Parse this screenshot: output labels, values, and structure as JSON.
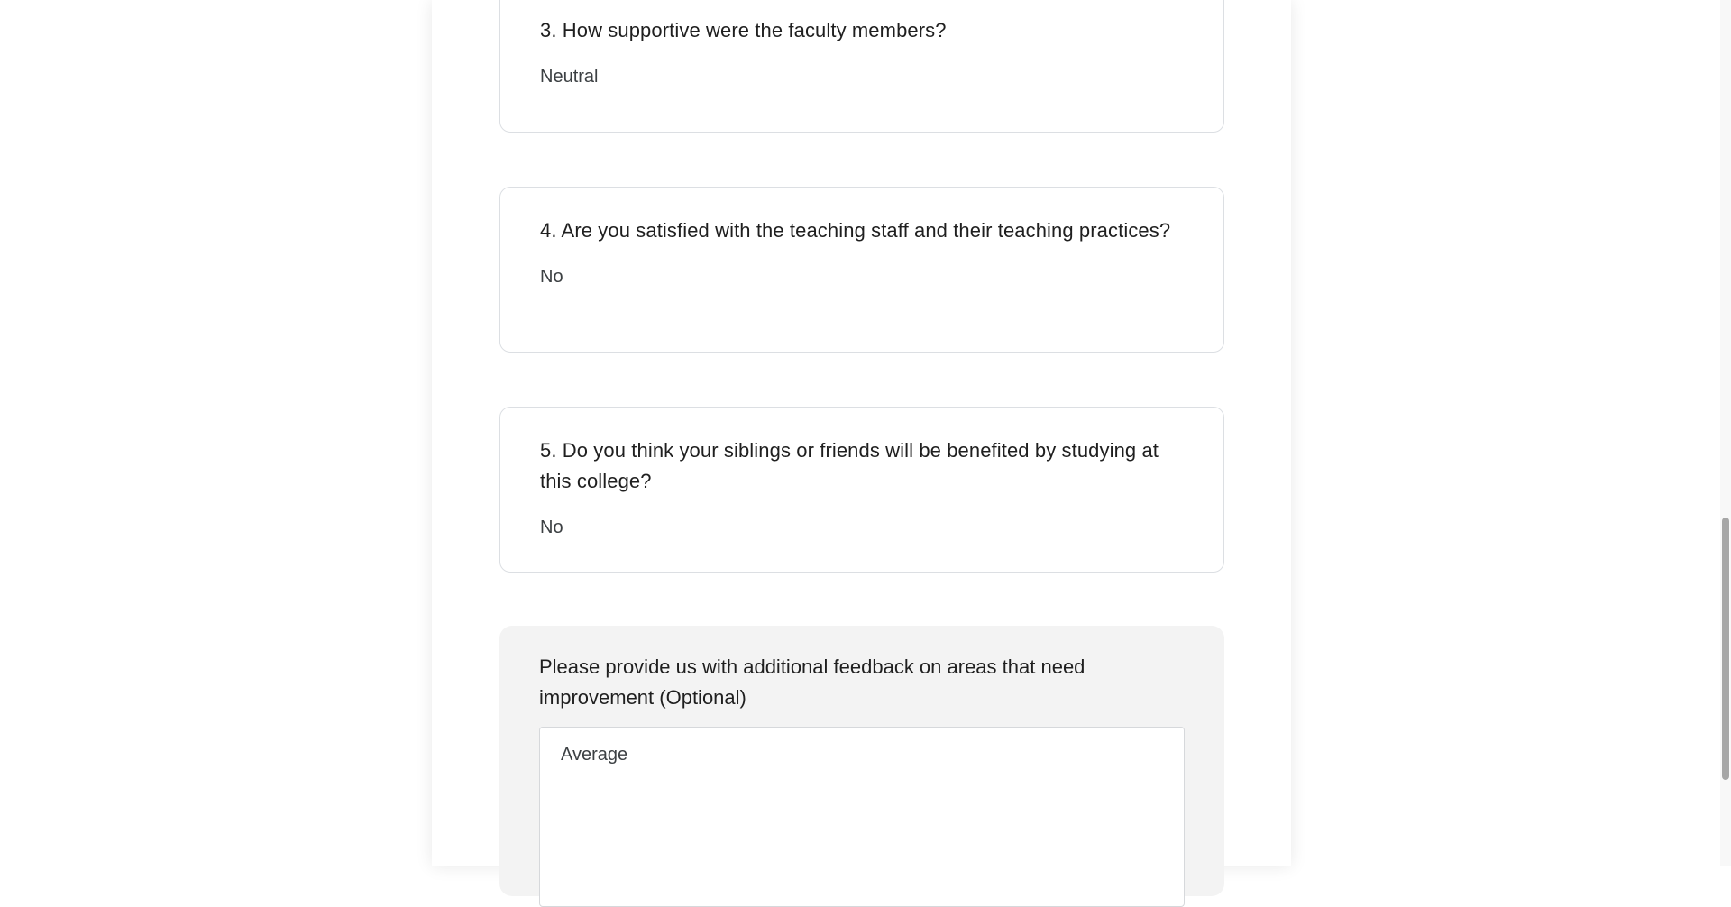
{
  "questions": [
    {
      "number": "3.",
      "text": "3. How supportive were the faculty members?",
      "answer": "Neutral"
    },
    {
      "number": "4.",
      "text": "4. Are you satisfied with the teaching staff and their teaching practices?",
      "answer": "No"
    },
    {
      "number": "5.",
      "text": "5. Do you think your siblings or friends will be benefited by studying at this college?",
      "answer": "No"
    }
  ],
  "feedback": {
    "label": "Please provide us with additional feedback on areas that need improvement (Optional)",
    "value": "Average"
  },
  "colors": {
    "card_border": "#dcdfe3",
    "feedback_background": "#f3f3f3",
    "scrollbar_thumb": "#a6a6a6"
  }
}
